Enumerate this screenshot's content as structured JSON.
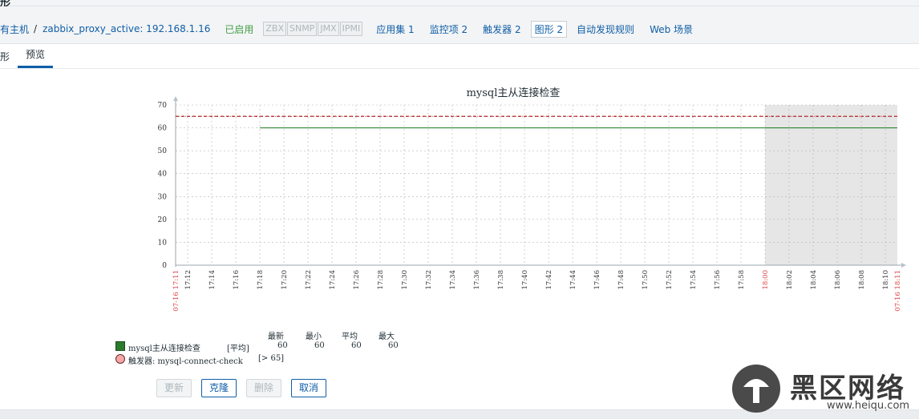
{
  "top_title_fragment": "形",
  "breadcrumb": {
    "all_hosts": "有主机",
    "separator": "/",
    "host": "zabbix_proxy_active: 192.168.1.16",
    "status": "已启用",
    "availability": [
      "ZBX",
      "SNMP",
      "JMX",
      "IPMI"
    ]
  },
  "host_nav": {
    "applications": "应用集 1",
    "items": "监控项 2",
    "triggers": "触发器 2",
    "graphs": "图形 2",
    "discovery": "自动发现规则",
    "web": "Web 场景"
  },
  "tabs": {
    "graph": "形",
    "preview": "预览"
  },
  "chart_data": {
    "type": "line",
    "title": "mysql主从连接检查",
    "ylim": [
      0,
      70
    ],
    "yticks": [
      "0",
      "10",
      "20",
      "30",
      "40",
      "50",
      "60",
      "70"
    ],
    "xticks": [
      "17:12",
      "17:14",
      "17:16",
      "17:18",
      "17:20",
      "17:22",
      "17:24",
      "17:26",
      "17:28",
      "17:30",
      "17:32",
      "17:34",
      "17:36",
      "17:38",
      "17:40",
      "17:42",
      "17:44",
      "17:46",
      "17:48",
      "17:50",
      "17:52",
      "17:54",
      "17:56",
      "17:58",
      "18:00",
      "18:02",
      "18:04",
      "18:06",
      "18:08",
      "18:10"
    ],
    "x_start_label": "07-16 17:11",
    "x_end_label": "07-16 18:11",
    "x_highlight_label": "18:00",
    "grid": true,
    "shaded_region": {
      "from": "18:00",
      "to": "18:11"
    },
    "series": [
      {
        "name": "mysql主从连接检查",
        "color": "#1a7a1a",
        "x_start": "17:18",
        "x_end": "18:11",
        "value": 60
      }
    ],
    "trigger": {
      "name": "触发器: mysql-connect-check",
      "value": 65,
      "color": "#d64545",
      "condition": "[> 65]"
    }
  },
  "legend": {
    "headers": [
      "最新",
      "最小",
      "平均",
      "最大"
    ],
    "series_label": "mysql主从连接检查",
    "series_func": "[平均]",
    "series_values": [
      "60",
      "60",
      "60",
      "60"
    ],
    "trigger_label": "触发器: mysql-connect-check",
    "trigger_condition": "[> 65]"
  },
  "buttons": {
    "update": "更新",
    "clone": "克隆",
    "delete": "删除",
    "cancel": "取消"
  },
  "watermark": {
    "cn": "黑区网络",
    "en": "www.heiqu.com"
  },
  "colors": {
    "link": "#0f5ea8",
    "enabled": "#429e47",
    "series": "#1a7a1a",
    "trigger": "#d64545",
    "highlight_label": "#e04040"
  }
}
